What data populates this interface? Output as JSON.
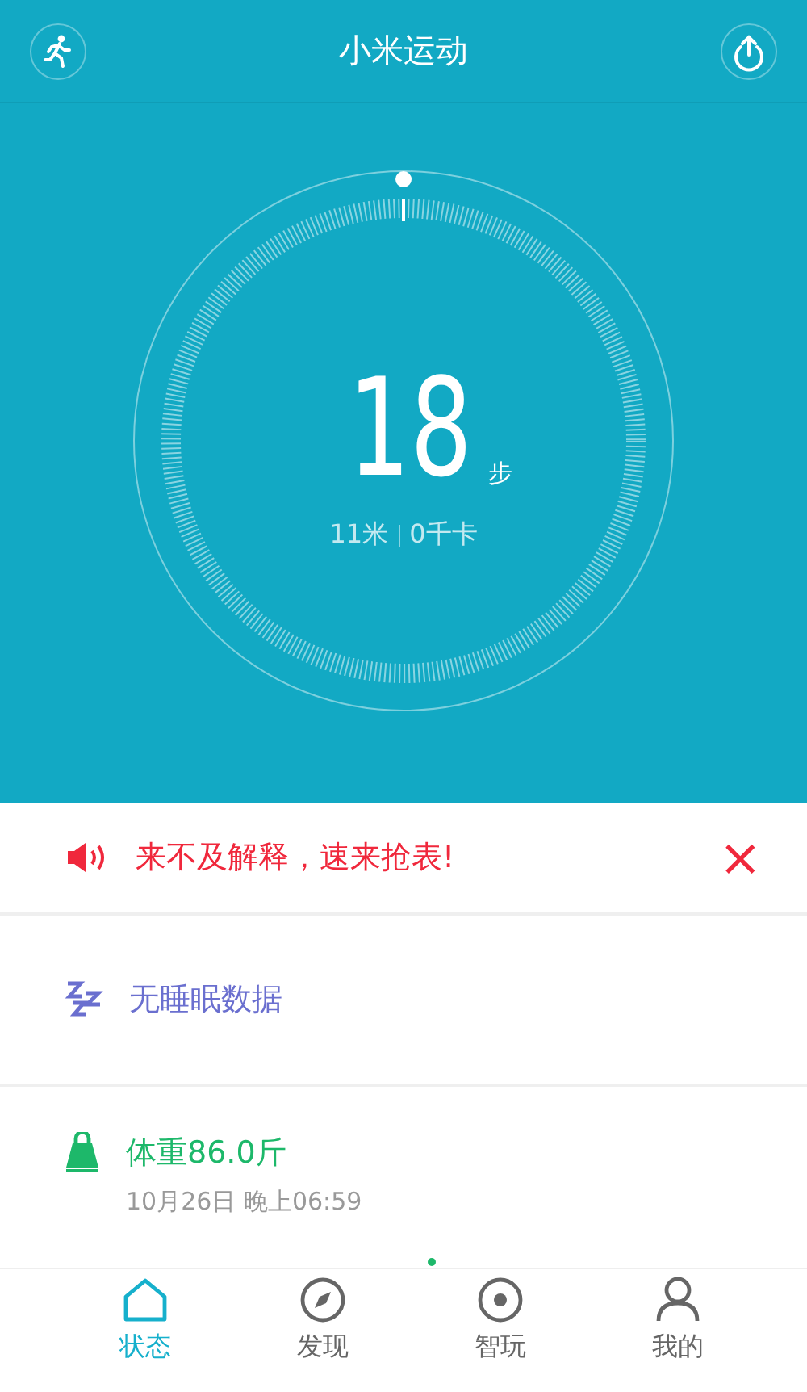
{
  "header": {
    "title": "小米运动"
  },
  "summary": {
    "steps": "18",
    "steps_unit": "步",
    "distance": "11米",
    "calories": "0千卡"
  },
  "cards": [
    {
      "kind": "alert",
      "text": "来不及解释，速来抢表!",
      "close": "×"
    },
    {
      "kind": "sleep",
      "text": "无睡眠数据"
    },
    {
      "kind": "weight",
      "text": "体重86.0斤",
      "time": "10月26日 晚上06:59"
    }
  ],
  "tabs": [
    {
      "label": "状态",
      "kind": "home",
      "selected": true
    },
    {
      "label": "发现",
      "kind": "compass",
      "selected": false
    },
    {
      "label": "智玩",
      "kind": "target",
      "selected": false
    },
    {
      "label": "我的",
      "kind": "person",
      "selected": false
    }
  ]
}
